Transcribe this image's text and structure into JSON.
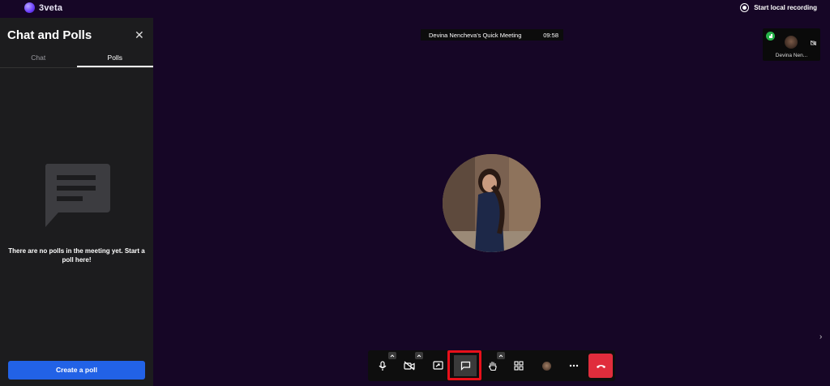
{
  "app": {
    "brand": "3veta",
    "recording_label": "Start local recording"
  },
  "sidebar": {
    "title": "Chat and Polls",
    "tabs": [
      {
        "label": "Chat",
        "active": false
      },
      {
        "label": "Polls",
        "active": true
      }
    ],
    "empty_message": "There are no polls in the meeting yet. Start a poll here!",
    "create_button": "Create a poll"
  },
  "meeting": {
    "title": "Devina Nencheva's Quick Meeting",
    "timer": "09:58"
  },
  "participant": {
    "name": "Devina Nen..."
  },
  "toolbar": {
    "buttons": [
      "microphone-icon",
      "camera-off-icon",
      "share-screen-icon",
      "chat-icon",
      "raise-hand-icon",
      "grid-view-icon",
      "participant-avatar",
      "more-icon",
      "hang-up-icon"
    ],
    "active": "chat-icon"
  },
  "colors": {
    "background": "#160626",
    "sidebar": "#1c1c1e",
    "primary_button": "#2262e6",
    "hangup": "#e02d3c",
    "highlight": "#e8101a",
    "signal": "#27b24a"
  }
}
